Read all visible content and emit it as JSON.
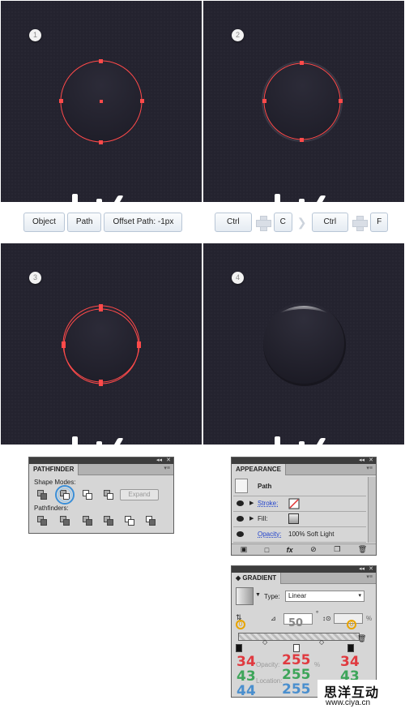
{
  "panels": [
    {
      "step": "1"
    },
    {
      "step": "2"
    },
    {
      "step": "3"
    },
    {
      "step": "4"
    }
  ],
  "toolbar_left": {
    "buttons": [
      "Object",
      "Path",
      "Offset Path: -1px"
    ]
  },
  "toolbar_right": {
    "keys": [
      "Ctrl",
      "C",
      "Ctrl",
      "F"
    ]
  },
  "pathfinder": {
    "tab": "PATHFINDER",
    "shape_modes_label": "Shape Modes:",
    "expand_label": "Expand",
    "pathfinders_label": "Pathfinders:"
  },
  "appearance": {
    "tab": "APPEARANCE",
    "path_label": "Path",
    "stroke_label": "Stroke:",
    "fill_label": "Fill:",
    "opacity_label": "Opacity:",
    "opacity_value": "100% Soft Light"
  },
  "gradient": {
    "tab": "GRADIENT",
    "type_label": "Type:",
    "type_value": "Linear",
    "angle_value": "50",
    "left_stop_marker": "0",
    "right_stop_marker": "0",
    "percent_sign": "%",
    "opacity_label": "Opacity:",
    "location_label": "Location:",
    "left_rgb": [
      "34",
      "43",
      "44"
    ],
    "mid_rgb": [
      "255",
      "255",
      "255"
    ],
    "right_rgb": [
      "34",
      "43"
    ]
  },
  "watermark": {
    "text": "思洋互动",
    "url": "www.ciya.cn"
  },
  "colors": {
    "canvas_bg": "#24232f",
    "path_stroke": "#ff4a4a",
    "button_border": "#b8c6d6"
  }
}
